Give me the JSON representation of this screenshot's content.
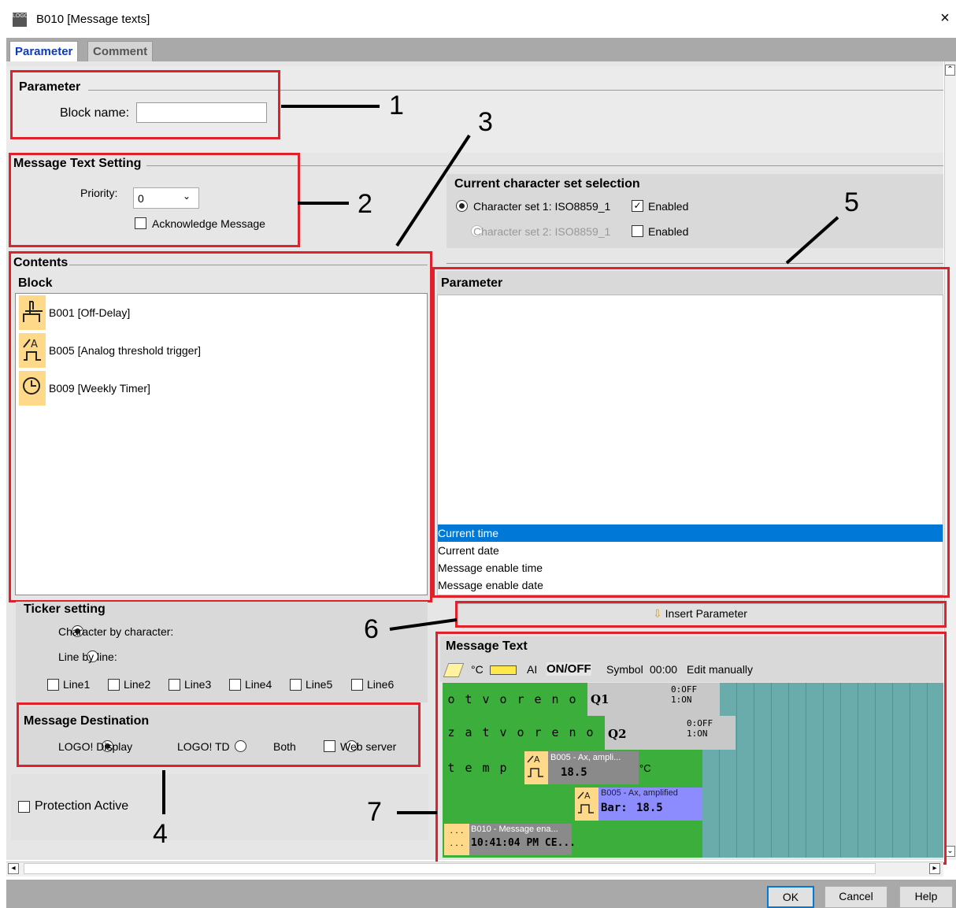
{
  "window": {
    "title": "B010 [Message texts]",
    "close": "×"
  },
  "tabs": [
    {
      "label": "Parameter"
    },
    {
      "label": "Comment"
    }
  ],
  "parameter_section": {
    "heading": "Parameter",
    "block_name_label": "Block name:",
    "block_name_value": ""
  },
  "message_text_setting": {
    "heading": "Message Text Setting",
    "priority_label": "Priority:",
    "priority_value": "0",
    "acknowledge_label": "Acknowledge Message"
  },
  "charset": {
    "heading": "Current character set selection",
    "set1_label": "Character set 1: ISO8859_1",
    "set1_enabled": "Enabled",
    "set2_label": "Character set 2: ISO8859_1",
    "set2_enabled": "Enabled"
  },
  "contents": {
    "heading": "Contents",
    "block_heading": "Block",
    "blocks": [
      {
        "label": "B001 [Off-Delay]"
      },
      {
        "label": "B005 [Analog threshold trigger]"
      },
      {
        "label": "B009 [Weekly Timer]"
      }
    ]
  },
  "param_panel": {
    "heading": "Parameter",
    "items": [
      {
        "label": "Current time"
      },
      {
        "label": "Current date"
      },
      {
        "label": "Message enable time"
      },
      {
        "label": "Message enable date"
      }
    ]
  },
  "ticker": {
    "heading": "Ticker setting",
    "char_by_char": "Character by character:",
    "line_by_line": "Line by line:",
    "lines": [
      "Line1",
      "Line2",
      "Line3",
      "Line4",
      "Line5",
      "Line6"
    ]
  },
  "insert_parameter": {
    "label": "Insert Parameter"
  },
  "destination": {
    "heading": "Message Destination",
    "logo_display": "LOGO! Display",
    "logo_td": "LOGO! TD",
    "both": "Both",
    "web_server": "Web server"
  },
  "protection": {
    "label": "Protection Active"
  },
  "message_text": {
    "heading": "Message Text",
    "toolbar": {
      "celsius": "°C",
      "ai": "AI",
      "onoff": "ON/OFF",
      "symbol": "Symbol",
      "time": "00:00",
      "edit": "Edit manually"
    },
    "line1_chars": [
      "o",
      "t",
      "v",
      "o",
      "r",
      "e",
      "n",
      "o"
    ],
    "line1_tag": "Q1",
    "line1_state": "0:OFF\n1:ON",
    "line2_chars": [
      "z",
      "a",
      "t",
      "v",
      "o",
      "r",
      "e",
      "n",
      "o"
    ],
    "line2_tag": "Q2",
    "line2_state": "0:OFF\n1:ON",
    "line3_chars": [
      "t",
      "e",
      "m",
      "p"
    ],
    "line3_block": "B005 - Ax, ampli...",
    "line3_value": "18.5",
    "line3_unit": "°C",
    "line4_block": "B005 - Ax, amplified",
    "line4_value_label": "Bar:",
    "line4_value": "18.5",
    "line5_block": "B010 - Message ena...",
    "line5_value": "10:41:04 PM CE..."
  },
  "buttons": {
    "ok": "OK",
    "cancel": "Cancel",
    "help": "Help"
  },
  "callouts": [
    "1",
    "2",
    "3",
    "4",
    "5",
    "6",
    "7"
  ],
  "colors": {
    "annotation_red": "#e0202a",
    "selection_blue": "#0078d7",
    "grid_green": "#3cae3c",
    "grid_teal": "#6aabab"
  }
}
